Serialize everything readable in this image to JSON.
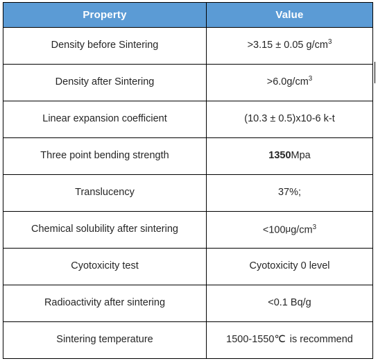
{
  "table": {
    "title": "Material property specification table",
    "header": {
      "property_label": "Property",
      "value_label": "Value",
      "background_color": "#5B9BD5",
      "text_color": "#FFFFFF"
    },
    "border_color": "#000000",
    "body_text_color": "#262626",
    "columns": [
      "Property",
      "Value"
    ],
    "rows": [
      {
        "property": "Density before Sintering",
        "value": ">3.15 ±  0.05 g/cm³",
        "value_prefix": ">3.15 ±  0.05 g/cm",
        "value_sup": "3",
        "value_bold": ""
      },
      {
        "property": "Density after Sintering",
        "value": ">6.0g/cm³",
        "value_prefix": ">6.0g/cm",
        "value_sup": "3",
        "value_bold": ""
      },
      {
        "property": "Linear expansion coefficient",
        "value": "(10.3  ± 0.5)x10-6 k-t",
        "value_prefix": "(10.3  ± 0.5)x10-6 k-t",
        "value_sup": "",
        "value_bold": ""
      },
      {
        "property": "Three point bending strength",
        "value": "1350Mpa",
        "value_prefix": "Mpa",
        "value_sup": "",
        "value_bold": "1350"
      },
      {
        "property": "Translucency",
        "value": "37%;",
        "value_prefix": "37%;",
        "value_sup": "",
        "value_bold": ""
      },
      {
        "property": "Chemical solubility after sintering",
        "value": "<100μg/cm³",
        "value_prefix": "<100",
        "value_mu": "μ",
        "value_suffix": "g/cm",
        "value_sup": "3",
        "value_bold": ""
      },
      {
        "property": "Cyotoxicity test",
        "value": "Cyotoxicity 0 level",
        "value_prefix": "Cyotoxicity 0 level",
        "value_sup": "",
        "value_bold": ""
      },
      {
        "property": "Radioactivity after sintering",
        "value": "<0.1  Bq/g",
        "value_prefix": "<0.1  Bq/g",
        "value_sup": "",
        "value_bold": ""
      },
      {
        "property": "Sintering temperature",
        "value": "1500-1550℃  is recommend",
        "value_prefix": "1500-1550",
        "value_degc": "℃",
        "value_suffix": "is recommend",
        "value_sup": "",
        "value_bold": ""
      }
    ]
  }
}
